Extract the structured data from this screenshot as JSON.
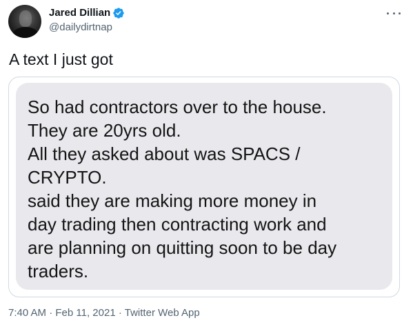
{
  "author": {
    "name": "Jared Dillian",
    "handle": "@dailydirtnap",
    "verified": true
  },
  "tweet": {
    "text": "A text I just got",
    "time": "7:40 AM",
    "separator": "·",
    "date": "Feb 11, 2021",
    "client": "Twitter Web App"
  },
  "message": {
    "lines": [
      "So had contractors over to the house.",
      " They are 20yrs old.",
      "All they asked about was SPACS /",
      "CRYPTO.",
      "said they are making more money in",
      "day trading then contracting work and",
      "are planning on quitting soon to be day",
      "traders."
    ]
  },
  "colors": {
    "verified_badge": "#1d9bf0",
    "secondary_text": "#536471",
    "bubble_bg": "#e8e8ed",
    "card_border": "#cfd9de"
  },
  "icons": {
    "verified": "verified-badge-icon",
    "more": "more-options-icon"
  }
}
